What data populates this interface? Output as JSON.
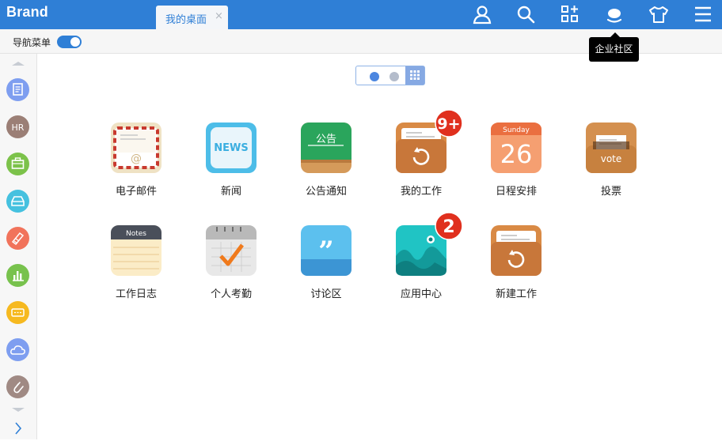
{
  "header": {
    "brand": "Brand",
    "tab_label": "我的桌面",
    "tab_close": "×",
    "tooltip": "企业社区"
  },
  "nav": {
    "label": "导航菜单",
    "enabled": true
  },
  "sidebar": {
    "items": [
      {
        "icon": "document-icon",
        "color": "#7e9ef0"
      },
      {
        "icon": "hr-icon",
        "color": "#9b7f76",
        "text": "HR"
      },
      {
        "icon": "briefcase-icon",
        "color": "#7cc24a"
      },
      {
        "icon": "inbox-icon",
        "color": "#45c1df"
      },
      {
        "icon": "notes-icon",
        "color": "#f1735b"
      },
      {
        "icon": "chart-icon",
        "color": "#78c24d"
      },
      {
        "icon": "message-icon",
        "color": "#f6b920"
      },
      {
        "icon": "cloud-icon",
        "color": "#7e9ef0"
      },
      {
        "icon": "paperclip-icon",
        "color": "#a08a84"
      }
    ]
  },
  "pager": {
    "current": 0,
    "total": 2
  },
  "apps": [
    {
      "id": "email",
      "label": "电子邮件"
    },
    {
      "id": "news",
      "label": "新闻",
      "icon_text": "NEWS"
    },
    {
      "id": "notice",
      "label": "公告通知",
      "icon_text": "公告"
    },
    {
      "id": "mywork",
      "label": "我的工作",
      "badge": "9+"
    },
    {
      "id": "calendar",
      "label": "日程安排",
      "icon_text": "Sunday",
      "icon_num": "26"
    },
    {
      "id": "vote",
      "label": "投票",
      "icon_text": "vote"
    },
    {
      "id": "diary",
      "label": "工作日志",
      "icon_text": "Notes"
    },
    {
      "id": "attendance",
      "label": "个人考勤"
    },
    {
      "id": "forum",
      "label": "讨论区"
    },
    {
      "id": "appcenter",
      "label": "应用中心",
      "badge": "2"
    },
    {
      "id": "newwork",
      "label": "新建工作"
    }
  ]
}
